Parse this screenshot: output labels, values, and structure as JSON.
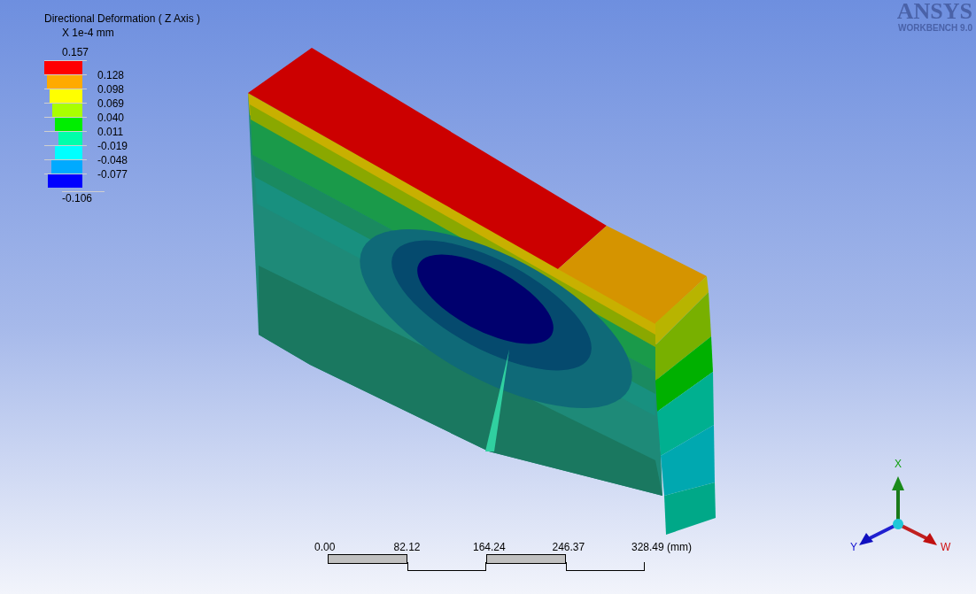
{
  "legend": {
    "title": "Directional Deformation ( Z Axis )",
    "units": "X 1e-4 mm",
    "max": "0.157",
    "min": "-0.106",
    "bands": [
      {
        "color": "#ff0000",
        "label": "0.128"
      },
      {
        "color": "#ffaa00",
        "label": "0.098"
      },
      {
        "color": "#ffff00",
        "label": "0.069"
      },
      {
        "color": "#aaff00",
        "label": "0.040"
      },
      {
        "color": "#00ee00",
        "label": "0.011"
      },
      {
        "color": "#00ffaa",
        "label": "-0.019"
      },
      {
        "color": "#00ffff",
        "label": "-0.048"
      },
      {
        "color": "#00aaff",
        "label": "-0.077"
      },
      {
        "color": "#0000ff"
      }
    ]
  },
  "logo": {
    "brand": "ANSYS",
    "product": "WORKBENCH 9.0"
  },
  "scale_bar": {
    "ticks": [
      "0.00",
      "82.12",
      "164.24",
      "246.37",
      "328.49 (mm)"
    ]
  },
  "triad": {
    "up": "X",
    "left": "Y",
    "right": "W"
  }
}
